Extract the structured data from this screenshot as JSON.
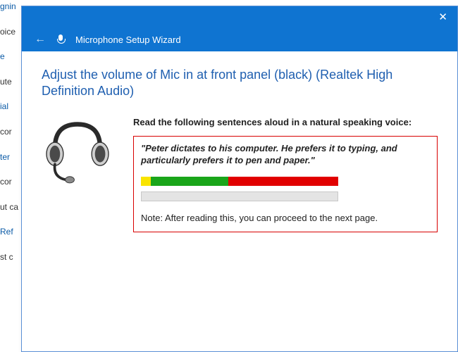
{
  "bg": {
    "f1": "gnin",
    "f2": "oice",
    "f3": "e",
    "f4": "ute",
    "f5": "ial",
    "f6": "cor",
    "f7": "ter",
    "f8": "cor",
    "f9": "ut ca",
    "f10": "Ref",
    "f11": "st c"
  },
  "titlebar": {
    "close": "✕"
  },
  "subtitle": {
    "back": "←",
    "title": "Microphone Setup Wizard"
  },
  "heading": "Adjust the volume of Mic in at front panel (black) (Realtek High Definition Audio)",
  "instruction": "Read the following sentences aloud in a natural speaking voice:",
  "sample": "\"Peter dictates to his computer. He prefers it to typing, and particularly prefers it to pen and paper.\"",
  "note": "Note: After reading this, you can proceed to the next page."
}
